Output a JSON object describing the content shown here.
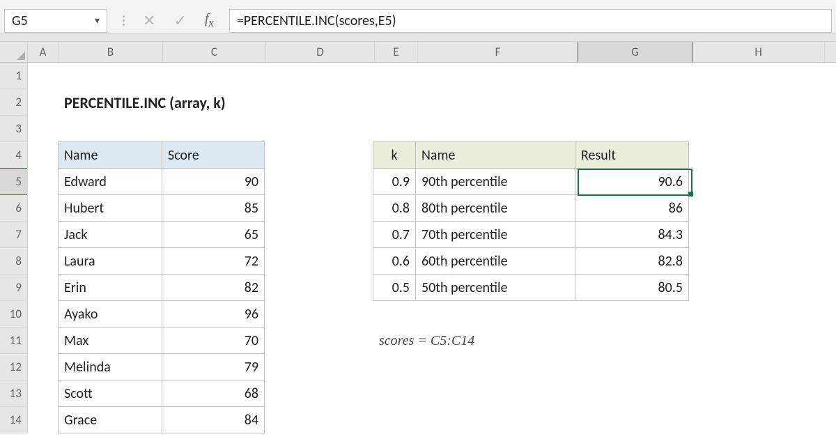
{
  "name_box": "G5",
  "formula": "=PERCENTILE.INC(scores,E5)",
  "columns": [
    "A",
    "B",
    "C",
    "D",
    "E",
    "F",
    "G",
    "H"
  ],
  "rows": [
    "1",
    "2",
    "3",
    "4",
    "5",
    "6",
    "7",
    "8",
    "9",
    "10",
    "11",
    "12",
    "13",
    "14"
  ],
  "active": {
    "col": "G",
    "row": "5"
  },
  "title": "PERCENTILE.INC (array, k)",
  "note": "scores = C5:C14",
  "table_left": {
    "headers": [
      "Name",
      "Score"
    ],
    "rows": [
      {
        "name": "Edward",
        "score": 90
      },
      {
        "name": "Hubert",
        "score": 85
      },
      {
        "name": "Jack",
        "score": 65
      },
      {
        "name": "Laura",
        "score": 72
      },
      {
        "name": "Erin",
        "score": 82
      },
      {
        "name": "Ayako",
        "score": 96
      },
      {
        "name": "Max",
        "score": 70
      },
      {
        "name": "Melinda",
        "score": 79
      },
      {
        "name": "Scott",
        "score": 68
      },
      {
        "name": "Grace",
        "score": 84
      }
    ]
  },
  "table_right": {
    "headers": [
      "k",
      "Name",
      "Result"
    ],
    "rows": [
      {
        "k": 0.9,
        "name": "90th percentile",
        "result": 90.6
      },
      {
        "k": 0.8,
        "name": "80th percentile",
        "result": 86
      },
      {
        "k": 0.7,
        "name": "70th percentile",
        "result": 84.3
      },
      {
        "k": 0.6,
        "name": "60th percentile",
        "result": 82.8
      },
      {
        "k": 0.5,
        "name": "50th percentile",
        "result": 80.5
      }
    ]
  }
}
